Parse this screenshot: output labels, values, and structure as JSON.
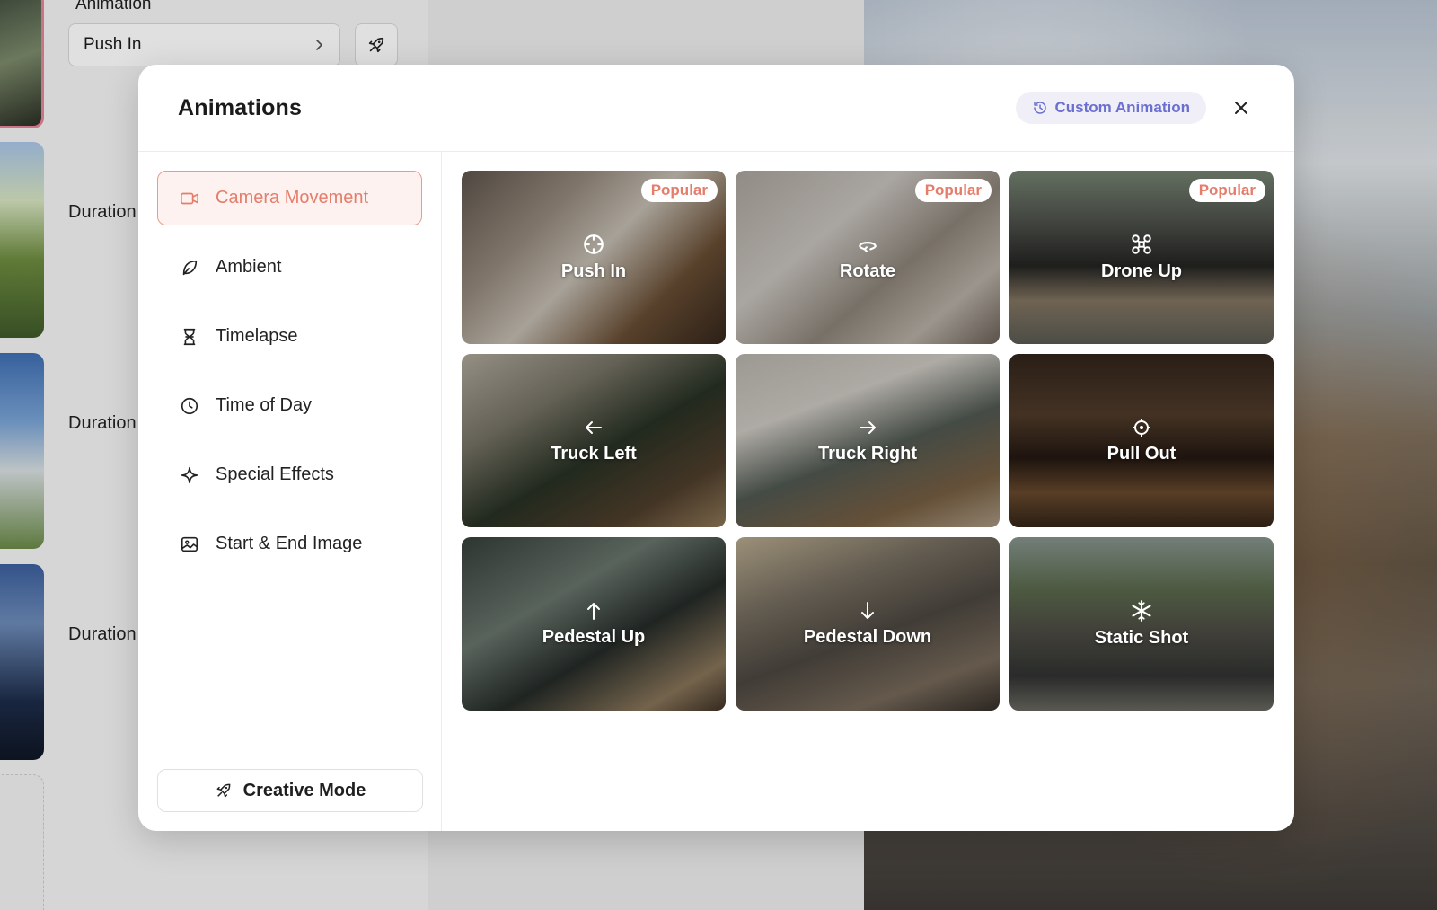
{
  "background": {
    "animation_label": "Animation",
    "animation_value": "Push In",
    "duration_label": "Duration"
  },
  "modal": {
    "title": "Animations",
    "custom_animation": "Custom Animation",
    "categories": [
      {
        "label": "Camera Movement",
        "icon": "camera-icon",
        "active": true
      },
      {
        "label": "Ambient",
        "icon": "leaf-icon",
        "active": false
      },
      {
        "label": "Timelapse",
        "icon": "hourglass-icon",
        "active": false
      },
      {
        "label": "Time of Day",
        "icon": "clock-icon",
        "active": false
      },
      {
        "label": "Special Effects",
        "icon": "sparkle-icon",
        "active": false
      },
      {
        "label": "Start & End Image",
        "icon": "image-icon",
        "active": false
      }
    ],
    "creative_mode": "Creative Mode",
    "animations": [
      {
        "label": "Push In",
        "icon": "crosshair-icon",
        "badge": "Popular"
      },
      {
        "label": "Rotate",
        "icon": "rotate-icon",
        "badge": "Popular"
      },
      {
        "label": "Drone Up",
        "icon": "drone-icon",
        "badge": "Popular"
      },
      {
        "label": "Truck Left",
        "icon": "arrow-left-icon",
        "badge": ""
      },
      {
        "label": "Truck Right",
        "icon": "arrow-right-icon",
        "badge": ""
      },
      {
        "label": "Pull Out",
        "icon": "target-icon",
        "badge": ""
      },
      {
        "label": "Pedestal Up",
        "icon": "arrow-up-icon",
        "badge": ""
      },
      {
        "label": "Pedestal Down",
        "icon": "arrow-down-icon",
        "badge": ""
      },
      {
        "label": "Static Shot",
        "icon": "snowflake-icon",
        "badge": ""
      }
    ]
  },
  "colors": {
    "accent": "#e57d6b",
    "custom_accent": "#6b6fd0"
  }
}
